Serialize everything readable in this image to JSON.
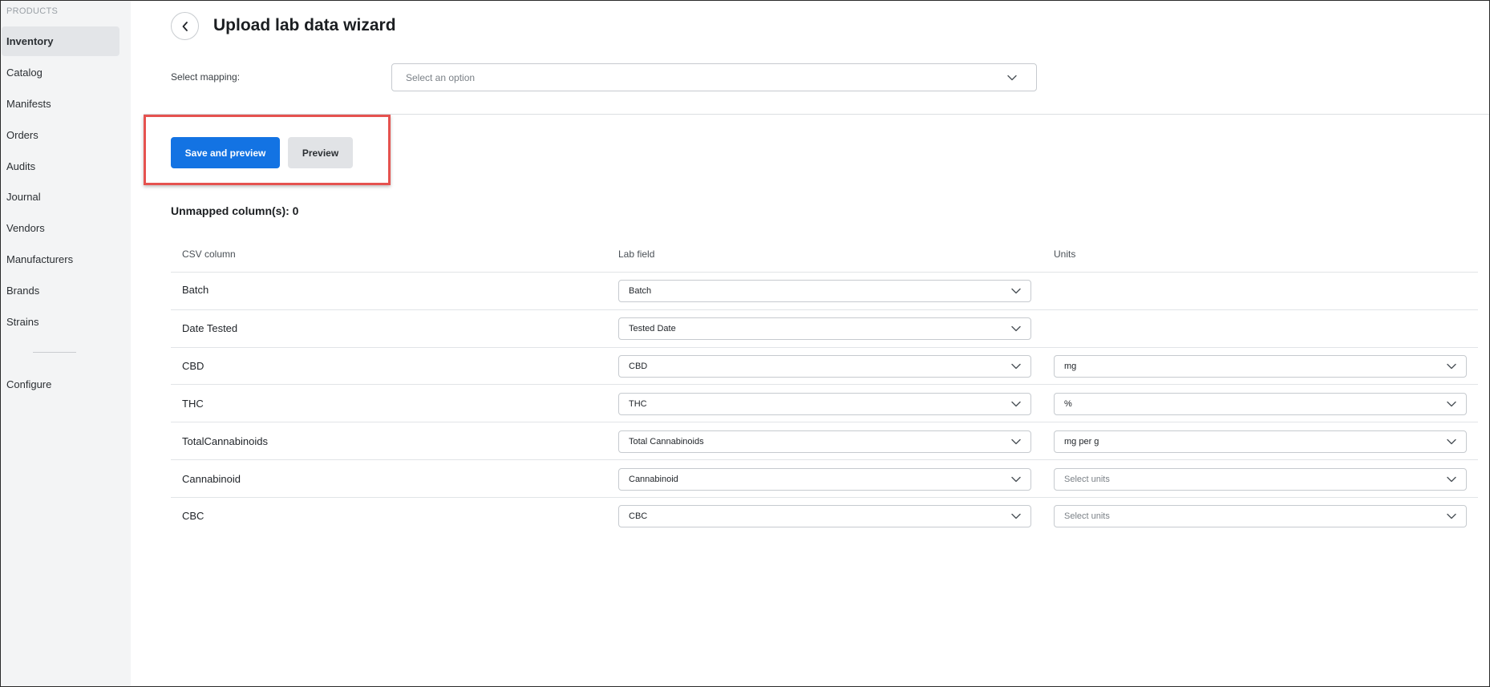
{
  "sidebar": {
    "section_label": "PRODUCTS",
    "items": [
      {
        "label": "Inventory",
        "active": true
      },
      {
        "label": "Catalog"
      },
      {
        "label": "Manifests"
      },
      {
        "label": "Orders"
      },
      {
        "label": "Audits"
      },
      {
        "label": "Journal"
      },
      {
        "label": "Vendors"
      },
      {
        "label": "Manufacturers"
      },
      {
        "label": "Brands"
      },
      {
        "label": "Strains"
      }
    ],
    "footer_item": "Configure"
  },
  "header": {
    "back_icon": "chevron-left-icon",
    "title": "Upload lab data wizard"
  },
  "mapping": {
    "label": "Select mapping:",
    "placeholder": "Select an option"
  },
  "actions": {
    "save_and_preview": "Save and preview",
    "preview": "Preview"
  },
  "unmapped": "Unmapped column(s): 0",
  "table": {
    "headers": [
      "CSV column",
      "Lab field",
      "Units"
    ],
    "rows": [
      {
        "csv": "Batch",
        "field": "Batch",
        "units": null
      },
      {
        "csv": "Date Tested",
        "field": "Tested Date",
        "units": null
      },
      {
        "csv": "CBD",
        "field": "CBD",
        "units": "mg"
      },
      {
        "csv": "THC",
        "field": "THC",
        "units": "%"
      },
      {
        "csv": "TotalCannabinoids",
        "field": "Total Cannabinoids",
        "units": "mg per g"
      },
      {
        "csv": "Cannabinoid",
        "field": "Cannabinoid",
        "units": "",
        "units_placeholder": "Select units"
      },
      {
        "csv": "CBC",
        "field": "CBC",
        "units": "",
        "units_placeholder": "Select units"
      }
    ]
  },
  "colors": {
    "primary": "#1373e3",
    "highlight": "#e5524f",
    "sidebar_bg": "#f3f4f5"
  }
}
